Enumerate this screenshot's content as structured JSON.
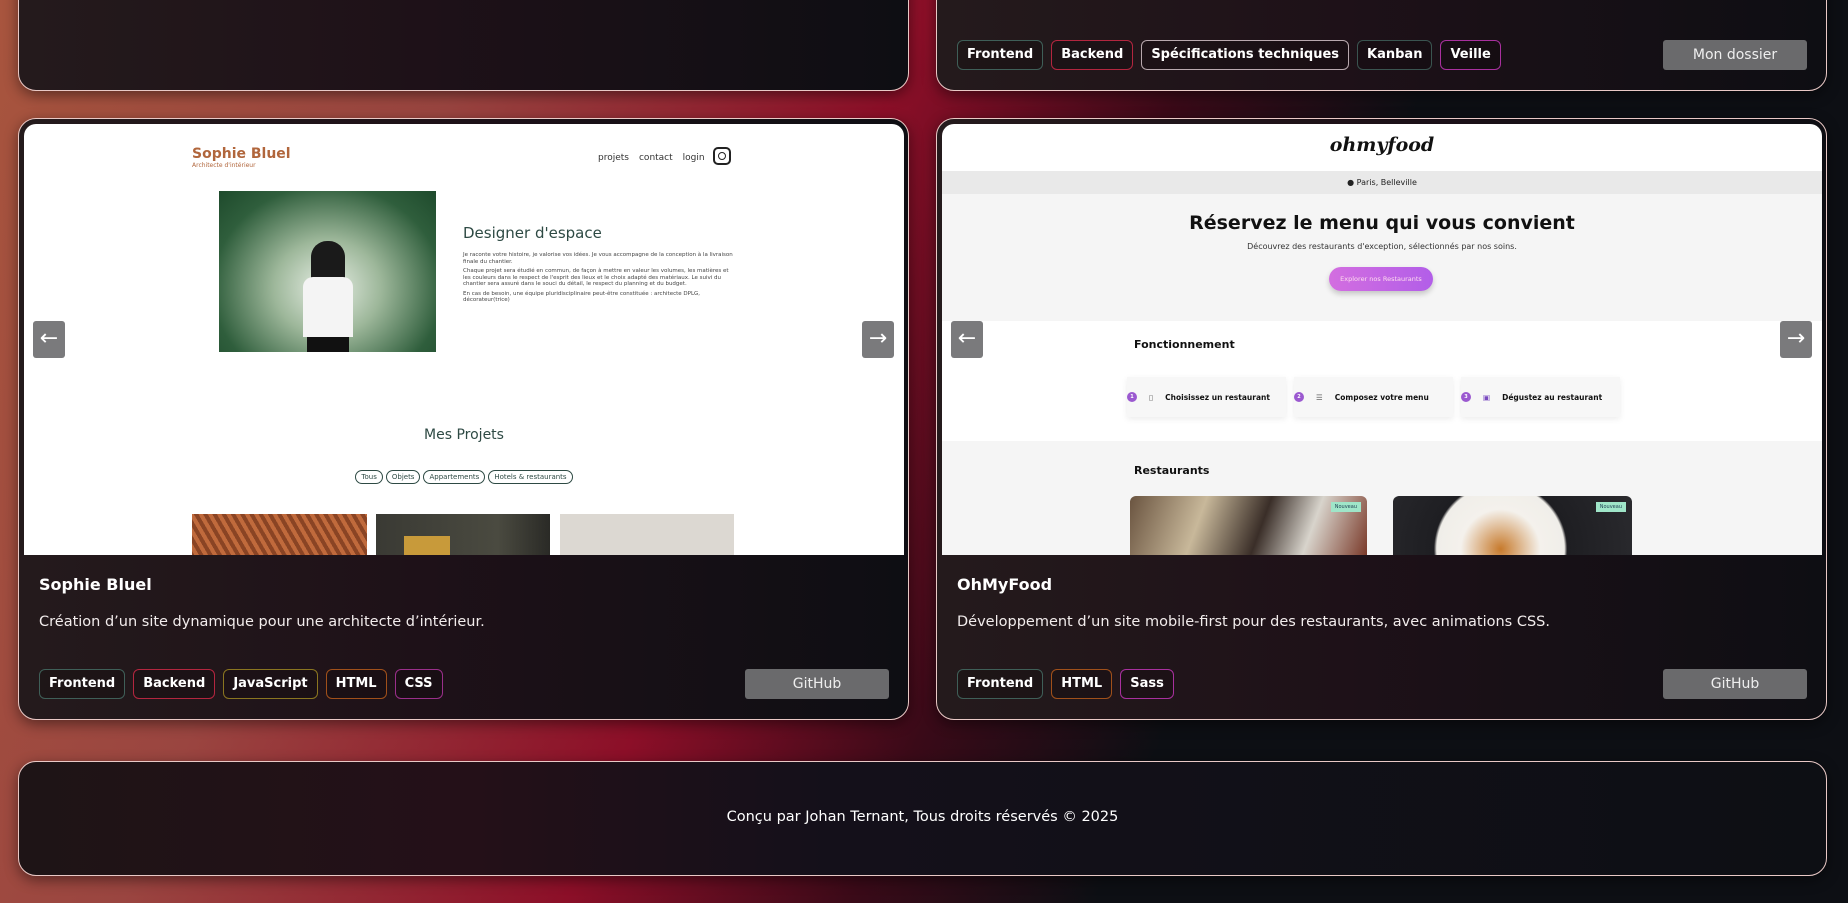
{
  "top_cards": [
    {
      "tags": []
    },
    {
      "tags": [
        {
          "label": "Frontend",
          "color": "#3f5f58"
        },
        {
          "label": "Backend",
          "color": "#b3263f"
        },
        {
          "label": "Spécifications techniques",
          "color": "#b8a8ae"
        },
        {
          "label": "Kanban",
          "color": "#3a5450"
        },
        {
          "label": "Veille",
          "color": "#a8309e"
        }
      ],
      "button": "Mon dossier"
    }
  ],
  "projects": [
    {
      "title": "Sophie Bluel",
      "description": "Création d’un site dynamique pour une architecte d’intérieur.",
      "tags": [
        {
          "label": "Frontend",
          "color": "#3f5f58"
        },
        {
          "label": "Backend",
          "color": "#b3263f"
        },
        {
          "label": "JavaScript",
          "color": "#8a7520"
        },
        {
          "label": "HTML",
          "color": "#a0501a"
        },
        {
          "label": "CSS",
          "color": "#9a2f8a"
        }
      ],
      "button": "GitHub",
      "preview": {
        "logo": "Sophie Bluel",
        "logo_sub": "Architecte d'intérieur",
        "nav": [
          "projets",
          "contact",
          "login"
        ],
        "heading": "Designer d'espace",
        "paragraphs": [
          "Je raconte votre histoire, je valorise vos idées. Je vous accompagne de la conception à la livraison finale du chantier.",
          "Chaque projet sera étudié en commun, de façon à mettre en valeur les volumes, les matières et les couleurs dans le respect de l'esprit des lieux et le choix adapté des matériaux. Le suivi du chantier sera assuré dans le souci du détail, le respect du planning et du budget.",
          "En cas de besoin, une équipe pluridisciplinaire peut-être constituée : architecte DPLG, décorateur(trice)"
        ],
        "section": "Mes Projets",
        "filters": [
          "Tous",
          "Objets",
          "Appartements",
          "Hotels & restaurants"
        ]
      }
    },
    {
      "title": "OhMyFood",
      "description": "Développement d’un site mobile-first pour des restaurants, avec animations CSS.",
      "tags": [
        {
          "label": "Frontend",
          "color": "#3f5f58"
        },
        {
          "label": "HTML",
          "color": "#a0501a"
        },
        {
          "label": "Sass",
          "color": "#a8309e"
        }
      ],
      "button": "GitHub",
      "preview": {
        "logo": "ohmyfood",
        "location": "Paris, Belleville",
        "hero_title": "Réservez le menu qui vous convient",
        "hero_sub": "Découvrez des restaurants d'exception, sélectionnés par nos soins.",
        "hero_button": "Explorer nos Restaurants",
        "section1": "Fonctionnement",
        "steps": [
          {
            "n": "1",
            "label": "Choisissez un restaurant"
          },
          {
            "n": "2",
            "label": "Composez votre menu"
          },
          {
            "n": "3",
            "label": "Dégustez au restaurant"
          }
        ],
        "section2": "Restaurants",
        "badge": "Nouveau"
      }
    }
  ],
  "footer": "Conçu par Johan Ternant, Tous droits réservés © 2025"
}
